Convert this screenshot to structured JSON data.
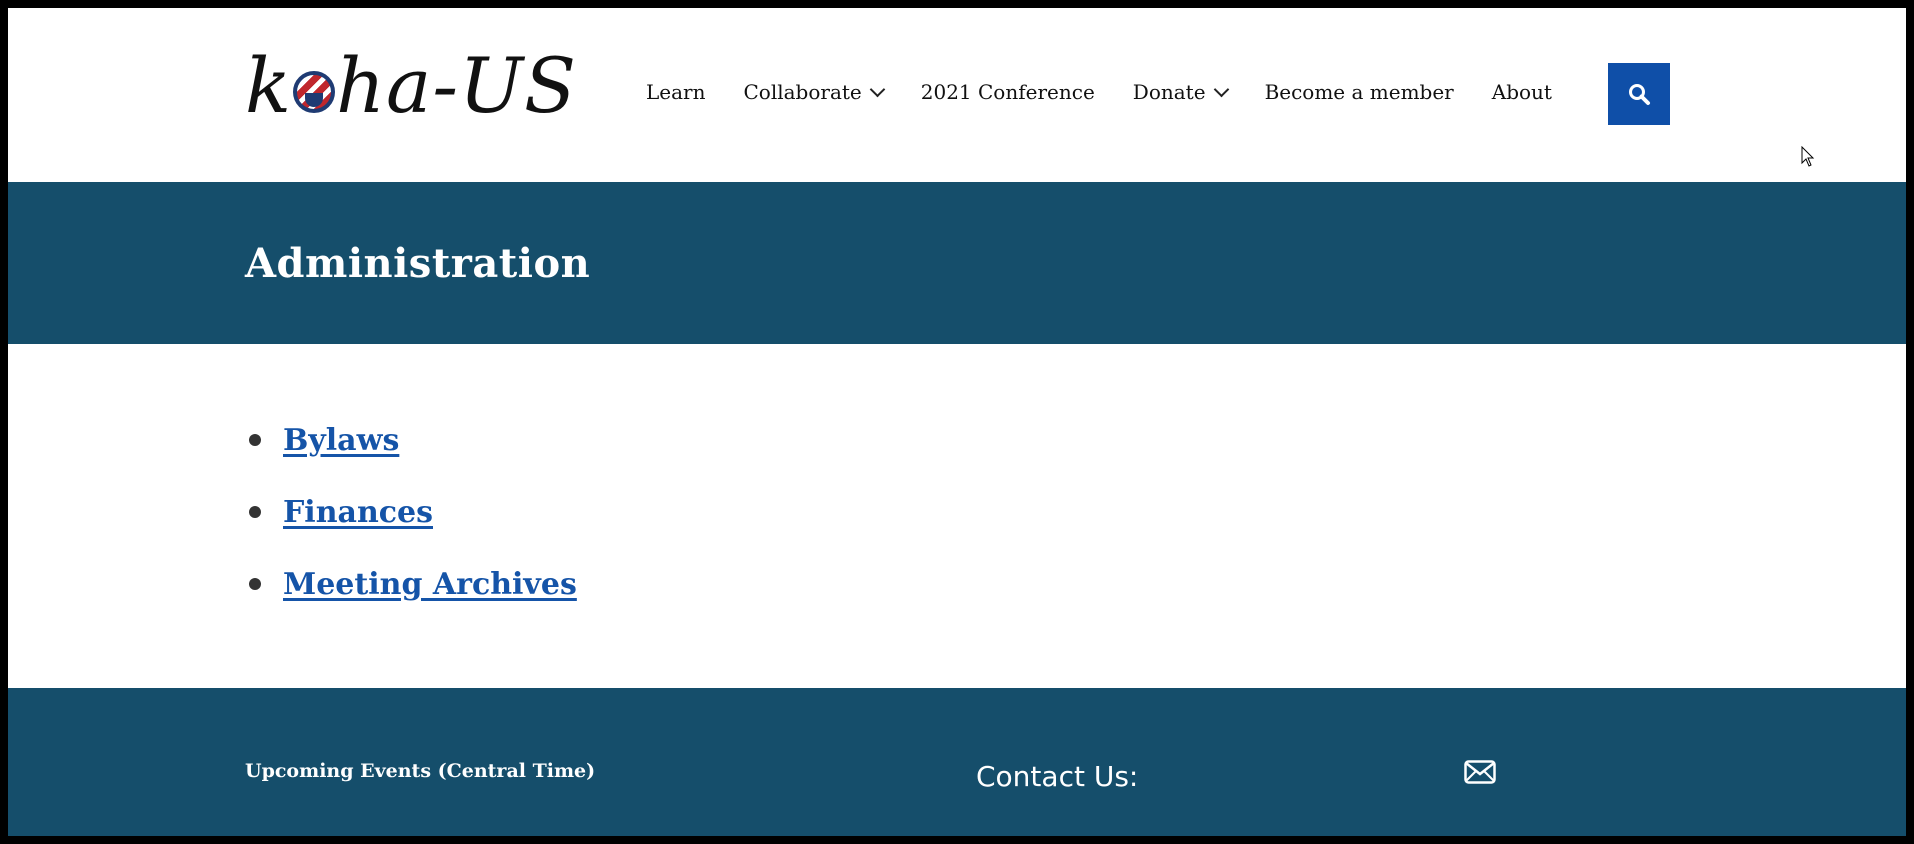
{
  "logo": {
    "pre": "k",
    "post": "ha-US"
  },
  "nav": {
    "items": [
      {
        "label": "Learn",
        "dropdown": false
      },
      {
        "label": "Collaborate",
        "dropdown": true
      },
      {
        "label": "2021 Conference",
        "dropdown": false
      },
      {
        "label": "Donate",
        "dropdown": true
      },
      {
        "label": "Become a member",
        "dropdown": false
      },
      {
        "label": "About",
        "dropdown": false
      }
    ],
    "search_icon": "search-icon"
  },
  "page": {
    "title": "Administration"
  },
  "links": [
    "Bylaws",
    "Finances",
    "Meeting Archives"
  ],
  "footer": {
    "events_title": "Upcoming Events (Central Time)",
    "contact_title": "Contact Us:",
    "mail_icon": "envelope-icon"
  },
  "colors": {
    "brand": "#154e6b",
    "accent": "#0f4fa8",
    "link": "#1554a8"
  }
}
